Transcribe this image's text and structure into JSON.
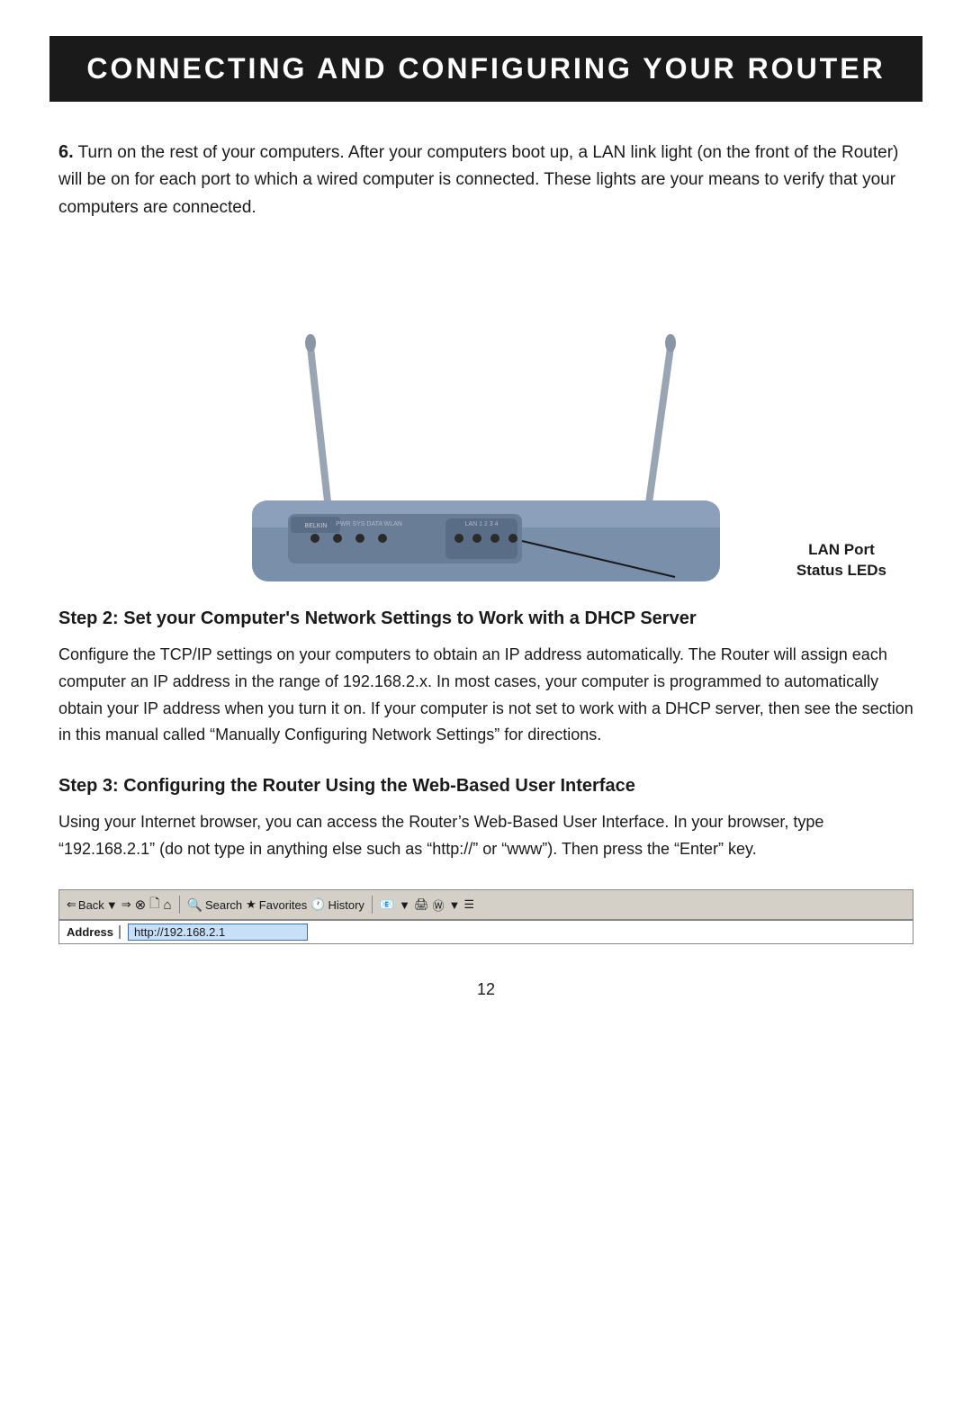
{
  "header": {
    "title": "CONNECTING AND CONFIGURING YOUR ROUTER"
  },
  "step6": {
    "number": "6.",
    "text": "Turn on the rest of your computers. After your computers boot up, a LAN link light (on the front of the Router) will be on for each port to which a wired computer is connected. These lights are your means to verify that your computers are connected."
  },
  "lan_port_label": {
    "line1": "LAN Port",
    "line2": "Status LEDs"
  },
  "step2": {
    "heading": "Step 2: Set your Computer's Network Settings to Work with a DHCP Server",
    "body": "Configure the TCP/IP settings on your computers to obtain an IP address automatically. The Router will assign each computer an IP address in the range of 192.168.2.x. In most cases, your computer is programmed to automatically obtain your IP address when you turn it on. If your computer is not set to work with a DHCP server, then see the section in this manual called “Manually Configuring Network Settings” for directions."
  },
  "step3": {
    "heading": "Step 3: Configuring the Router Using the Web-Based User Interface",
    "body": "Using your Internet browser, you can access the Router’s Web-Based User Interface. In your browser, type “192.168.2.1” (do not type in anything else such as “http://” or “www”). Then press the “Enter” key."
  },
  "browser": {
    "back_label": "Back",
    "forward_label": "→",
    "search_label": "Search",
    "favorites_label": "Favorites",
    "history_label": "History",
    "address_label": "Address",
    "url": "http://192.168.2.1",
    "icons": {
      "stop": "✕",
      "refresh": "🔄",
      "home": "⌂",
      "back_arrow": "⇐",
      "fwd_arrow": "⇒",
      "print": "🖨",
      "edit": "📝"
    }
  },
  "page_number": "12"
}
